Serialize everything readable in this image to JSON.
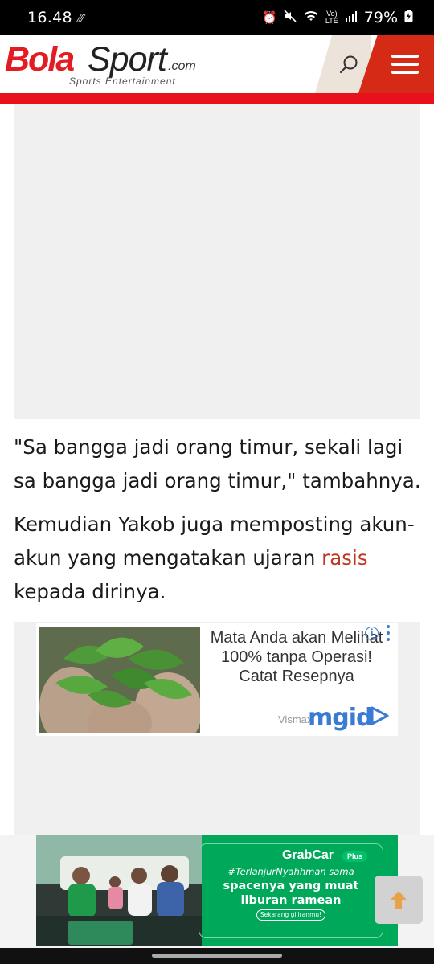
{
  "status_bar": {
    "time": "16.48",
    "battery": "79%",
    "network_label": "LTE",
    "volte_label": "Vo)"
  },
  "header": {
    "logo_bola": "Bola",
    "logo_sport": "Sport",
    "logo_com": ".com",
    "logo_tagline": "Sports Entertainment",
    "brand_red": "#e31c23",
    "menu_bg": "#d42a16"
  },
  "article": {
    "quote": "\"Sa bangga jadi orang timur, sekali lagi sa bangga jadi orang timur,\" tambahnya.",
    "para_before_link": "Kemudian Yakob juga memposting akun-akun yang mengatakan ujaran ",
    "link_text": "rasis",
    "para_after_link": " kepada dirinya.",
    "link_color": "#c0361f"
  },
  "native_ad": {
    "title": "Mata Anda akan Melihat 100% tanpa Operasi! Catat Resepnya",
    "source": "Vismax",
    "network": "mgid",
    "info_icon": "info-icon",
    "more_icon": "more-vertical-icon"
  },
  "banner_ad": {
    "brand": "GrabCar",
    "badge": "Plus",
    "hashtag": "#TerlanjurNyahhman sama",
    "line1": "spacenya yang muat",
    "line2": "liburan ramean",
    "cta": "Sekarang giliranmu!",
    "bg_color": "#00a859"
  },
  "controls": {
    "scroll_top_icon": "arrow-up-icon",
    "search_icon": "search-icon",
    "menu_icon": "hamburger-menu-icon"
  }
}
